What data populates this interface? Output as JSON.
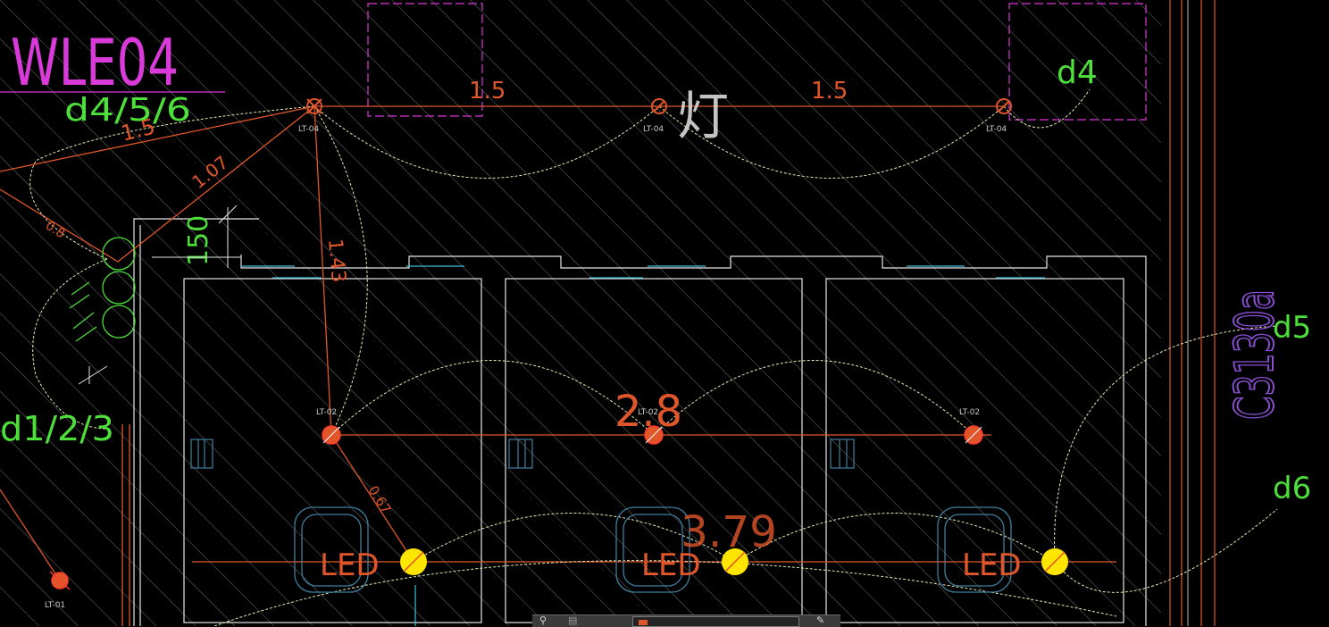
{
  "drawing": {
    "circuit_label": "WLE04",
    "room_labels": {
      "main": "d4/5/6",
      "left": "d1/2/3",
      "top_right": "d4",
      "right_upper": "d5",
      "right_lower": "d6"
    },
    "room_code_vertical": "C3130a",
    "handwritten_note": "灯",
    "dimensions": {
      "top_left": "1.5",
      "top_right": "1.5",
      "diag_upper": "1.5",
      "diag_107": "1.07",
      "diag_08": "0.8",
      "vert_143": "1.43",
      "mid_28": "2.8",
      "diag_067": "0.67",
      "low_379": "3.79",
      "vert_150": "150"
    },
    "fixture_tags": {
      "lt04": "LT-04",
      "lt02": "LT-02",
      "lt01": "LT-01"
    },
    "led_label": "LED"
  },
  "colors": {
    "background": "#000000",
    "wire": "#e0562a",
    "magenta": "#d93ad9",
    "green": "#4ddf3a",
    "white": "#e6e6e6",
    "cyan": "#3fbfd6",
    "yellow": "#ffe600",
    "dashed": "#e8e8b0",
    "purple": "#8a4fd2"
  },
  "statusbar": {
    "left_icon": "link-icon",
    "right_icon": "edit-icon",
    "field_value": ""
  }
}
